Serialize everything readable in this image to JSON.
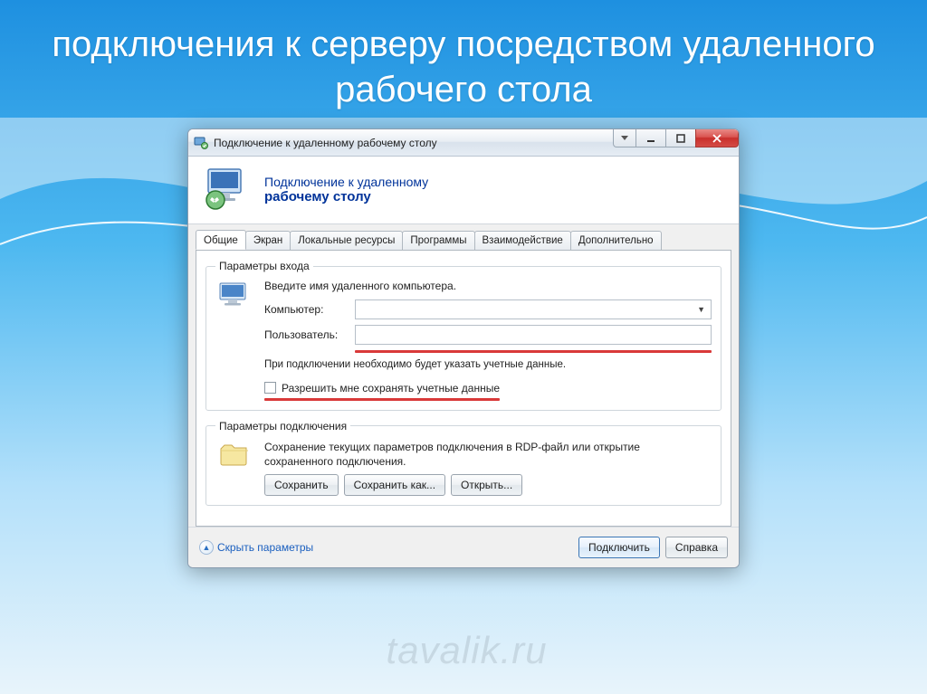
{
  "slide": {
    "title": "подключения к серверу посредством удаленного рабочего стола"
  },
  "window": {
    "title": "Подключение к удаленному рабочему столу"
  },
  "header": {
    "line1": "Подключение к удаленному",
    "line2": "рабочему столу"
  },
  "tabs": {
    "general": "Общие",
    "display": "Экран",
    "local": "Локальные ресурсы",
    "programs": "Программы",
    "experience": "Взаимодействие",
    "advanced": "Дополнительно"
  },
  "login_group": {
    "legend": "Параметры входа",
    "intro": "Введите имя удаленного компьютера.",
    "computer_label": "Компьютер:",
    "computer_value": "",
    "user_label": "Пользователь:",
    "user_value": "",
    "hint": "При подключении необходимо будет указать учетные данные.",
    "save_creds_label": "Разрешить мне сохранять учетные данные"
  },
  "conn_group": {
    "legend": "Параметры подключения",
    "desc": "Сохранение текущих параметров подключения в RDP-файл или открытие сохраненного подключения.",
    "save": "Сохранить",
    "save_as": "Сохранить как...",
    "open": "Открыть..."
  },
  "footer": {
    "hide": "Скрыть параметры",
    "connect": "Подключить",
    "help": "Справка"
  },
  "watermark": "tavalik.ru"
}
